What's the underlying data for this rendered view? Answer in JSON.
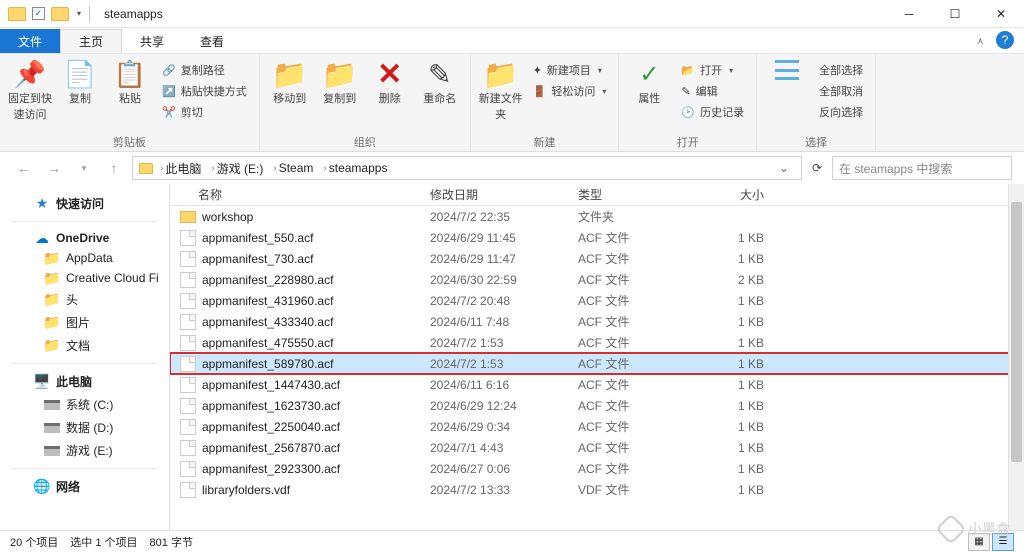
{
  "window": {
    "title": "steamapps"
  },
  "tabs": {
    "file": "文件",
    "home": "主页",
    "share": "共享",
    "view": "查看"
  },
  "ribbon": {
    "pin": "固定到快速访问",
    "copy": "复制",
    "paste": "粘贴",
    "copypath": "复制路径",
    "pasteshortcut": "粘贴快捷方式",
    "cut": "剪切",
    "moveto": "移动到",
    "copyto": "复制到",
    "delete": "删除",
    "rename": "重命名",
    "newfolder": "新建文件夹",
    "newitem": "新建项目",
    "easyaccess": "轻松访问",
    "properties": "属性",
    "open": "打开",
    "edit": "编辑",
    "history": "历史记录",
    "selectall": "全部选择",
    "selectnone": "全部取消",
    "invert": "反向选择",
    "group_clipboard": "剪贴板",
    "group_organize": "组织",
    "group_new": "新建",
    "group_open": "打开",
    "group_select": "选择"
  },
  "breadcrumb": {
    "thispc": "此电脑",
    "drive": "游戏 (E:)",
    "steam": "Steam",
    "steamapps": "steamapps"
  },
  "search": {
    "placeholder": "在 steamapps 中搜索"
  },
  "columns": {
    "name": "名称",
    "modified": "修改日期",
    "type": "类型",
    "size": "大小"
  },
  "files": [
    {
      "name": "workshop",
      "date": "2024/7/2 22:35",
      "type": "文件夹",
      "size": "",
      "isfolder": true,
      "sel": false
    },
    {
      "name": "appmanifest_550.acf",
      "date": "2024/6/29 11:45",
      "type": "ACF 文件",
      "size": "1 KB",
      "isfolder": false,
      "sel": false
    },
    {
      "name": "appmanifest_730.acf",
      "date": "2024/6/29 11:47",
      "type": "ACF 文件",
      "size": "1 KB",
      "isfolder": false,
      "sel": false
    },
    {
      "name": "appmanifest_228980.acf",
      "date": "2024/6/30 22:59",
      "type": "ACF 文件",
      "size": "2 KB",
      "isfolder": false,
      "sel": false
    },
    {
      "name": "appmanifest_431960.acf",
      "date": "2024/7/2 20:48",
      "type": "ACF 文件",
      "size": "1 KB",
      "isfolder": false,
      "sel": false
    },
    {
      "name": "appmanifest_433340.acf",
      "date": "2024/6/11 7:48",
      "type": "ACF 文件",
      "size": "1 KB",
      "isfolder": false,
      "sel": false
    },
    {
      "name": "appmanifest_475550.acf",
      "date": "2024/7/2 1:53",
      "type": "ACF 文件",
      "size": "1 KB",
      "isfolder": false,
      "sel": false
    },
    {
      "name": "appmanifest_589780.acf",
      "date": "2024/7/2 1:53",
      "type": "ACF 文件",
      "size": "1 KB",
      "isfolder": false,
      "sel": true
    },
    {
      "name": "appmanifest_1447430.acf",
      "date": "2024/6/11 6:16",
      "type": "ACF 文件",
      "size": "1 KB",
      "isfolder": false,
      "sel": false
    },
    {
      "name": "appmanifest_1623730.acf",
      "date": "2024/6/29 12:24",
      "type": "ACF 文件",
      "size": "1 KB",
      "isfolder": false,
      "sel": false
    },
    {
      "name": "appmanifest_2250040.acf",
      "date": "2024/6/29 0:34",
      "type": "ACF 文件",
      "size": "1 KB",
      "isfolder": false,
      "sel": false
    },
    {
      "name": "appmanifest_2567870.acf",
      "date": "2024/7/1 4:43",
      "type": "ACF 文件",
      "size": "1 KB",
      "isfolder": false,
      "sel": false
    },
    {
      "name": "appmanifest_2923300.acf",
      "date": "2024/6/27 0:06",
      "type": "ACF 文件",
      "size": "1 KB",
      "isfolder": false,
      "sel": false
    },
    {
      "name": "libraryfolders.vdf",
      "date": "2024/7/2 13:33",
      "type": "VDF 文件",
      "size": "1 KB",
      "isfolder": false,
      "sel": false
    }
  ],
  "nav": {
    "quickaccess": "快速访问",
    "onedrive": "OneDrive",
    "appdata": "AppData",
    "creative": "Creative Cloud Fi",
    "head": "头",
    "pictures": "图片",
    "documents": "文档",
    "thispc": "此电脑",
    "drive_c": "系统 (C:)",
    "drive_d": "数据 (D:)",
    "drive_e": "游戏 (E:)",
    "network": "网络"
  },
  "status": {
    "count": "20 个项目",
    "selected": "选中 1 个项目",
    "bytes": "801 字节"
  },
  "watermark": "小黑盒"
}
